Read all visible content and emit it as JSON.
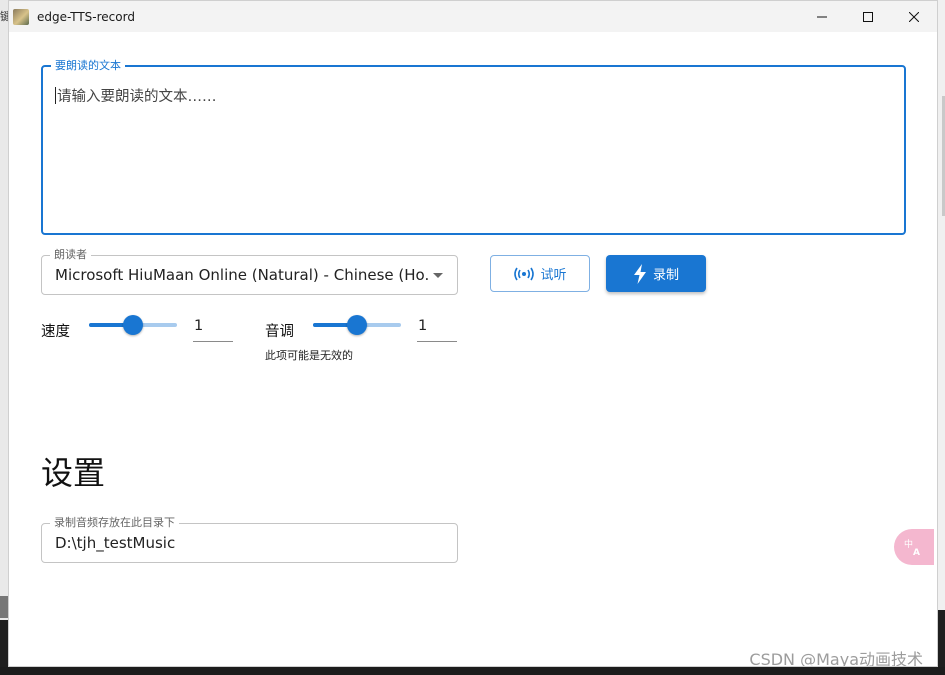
{
  "desktop": {
    "left_fragment_text": "键"
  },
  "window": {
    "title": "edge-TTS-record"
  },
  "text_input": {
    "label": "要朗读的文本",
    "placeholder": "请输入要朗读的文本……"
  },
  "voice_select": {
    "label": "朗读者",
    "value": "Microsoft HiuMaan Online (Natural) - Chinese (Ho..."
  },
  "buttons": {
    "preview_label": "试听",
    "record_label": "录制"
  },
  "speed": {
    "label": "速度",
    "value": "1",
    "slider_fraction": 0.5
  },
  "pitch": {
    "label": "音调",
    "value": "1",
    "slider_fraction": 0.5,
    "helper": "此项可能是无效的"
  },
  "settings": {
    "heading": "设置",
    "dir_label": "录制音频存放在此目录下",
    "dir_value": "D:\\tjh_testMusic"
  },
  "translate_icon": {
    "glyph": "中A"
  },
  "watermark": "CSDN @Maya动画技术",
  "colors": {
    "accent": "#1976d2",
    "track_light": "#a8cbee",
    "fab_pink": "#f4b7cf"
  }
}
